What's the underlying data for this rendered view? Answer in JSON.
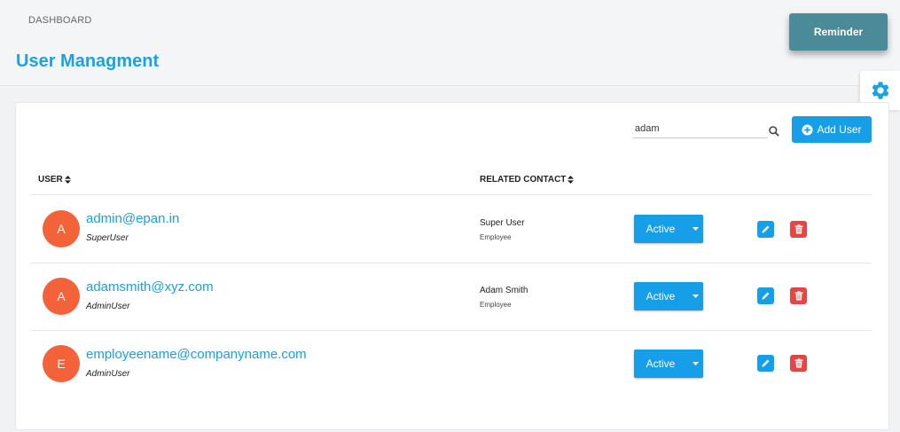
{
  "header": {
    "breadcrumb": "DASHBOARD",
    "page_title": "User Managment",
    "reminder_label": "Reminder"
  },
  "toolbar": {
    "search_value": "adam",
    "add_user_label": "Add User"
  },
  "table": {
    "columns": [
      {
        "label": "USER",
        "sortable": true
      },
      {
        "label": "RELATED CONTACT",
        "sortable": true
      }
    ],
    "rows": [
      {
        "initial": "A",
        "email": "admin@epan.in",
        "role": "SuperUser",
        "contact_name": "Super User",
        "contact_type": "Employee",
        "status": "Active"
      },
      {
        "initial": "A",
        "email": "adamsmith@xyz.com",
        "role": "AdminUser",
        "contact_name": "Adam Smith",
        "contact_type": "Employee",
        "status": "Active"
      },
      {
        "initial": "E",
        "email": "employeename@companyname.com",
        "role": "AdminUser",
        "contact_name": "",
        "contact_type": "",
        "status": "Active"
      }
    ]
  },
  "icons": {
    "settings": "gear-icon",
    "search": "search-icon",
    "add": "plus-circle-icon",
    "sort": "sort-icon",
    "dropdown": "caret-down-icon",
    "edit": "pencil-icon",
    "delete": "trash-icon"
  },
  "colors": {
    "accent": "#169ee8",
    "title": "#1aa3e0",
    "avatar": "#f4623a",
    "delete": "#e74545",
    "reminder": "#4a8a99"
  }
}
